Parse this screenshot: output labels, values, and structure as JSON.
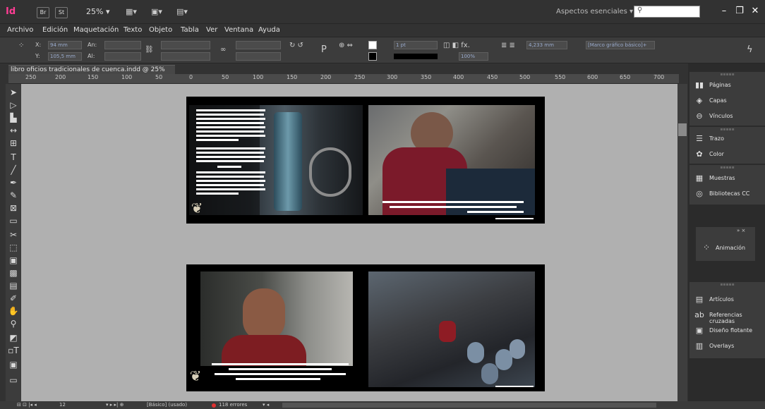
{
  "titlebar": {
    "app_logo": "Id",
    "bridge_label": "Br",
    "stock_label": "St",
    "zoom": "25%",
    "workspace_label": "Aspectos esenciales",
    "minimize": "–",
    "restore": "❐",
    "close": "✕"
  },
  "menu": [
    "Archivo",
    "Edición",
    "Maquetación",
    "Texto",
    "Objeto",
    "Tabla",
    "Ver",
    "Ventana",
    "Ayuda"
  ],
  "control": {
    "x_label": "X:",
    "x_value": "94 mm",
    "y_label": "Y:",
    "y_value": "105,5 mm",
    "w_label": "An:",
    "h_label": "Al:",
    "stroke_weight": "1 pt",
    "opacity": "100%",
    "stroke_offset": "4,233 mm",
    "frame_style": "[Marco gráfico básico]+"
  },
  "document": {
    "tab_title": "libro oficios tradicionales de cuenca.indd @ 25%",
    "ruler": [
      "250",
      "200",
      "150",
      "100",
      "50",
      "0",
      "50",
      "100",
      "150",
      "200",
      "250",
      "300",
      "350",
      "400",
      "450",
      "500",
      "550",
      "600",
      "650",
      "700"
    ]
  },
  "panels": {
    "group1": [
      "Páginas",
      "Capas",
      "Vínculos"
    ],
    "group2": [
      "Trazo",
      "Color"
    ],
    "group3": [
      "Muestras",
      "Bibliotecas CC"
    ],
    "animation": "Animación",
    "group4": [
      "Artículos",
      "Referencias cruzadas",
      "Diseño flotante",
      "Overlays"
    ]
  },
  "status": {
    "page": "12",
    "master": "[Básico] (usado)",
    "errors": "118 errores"
  }
}
